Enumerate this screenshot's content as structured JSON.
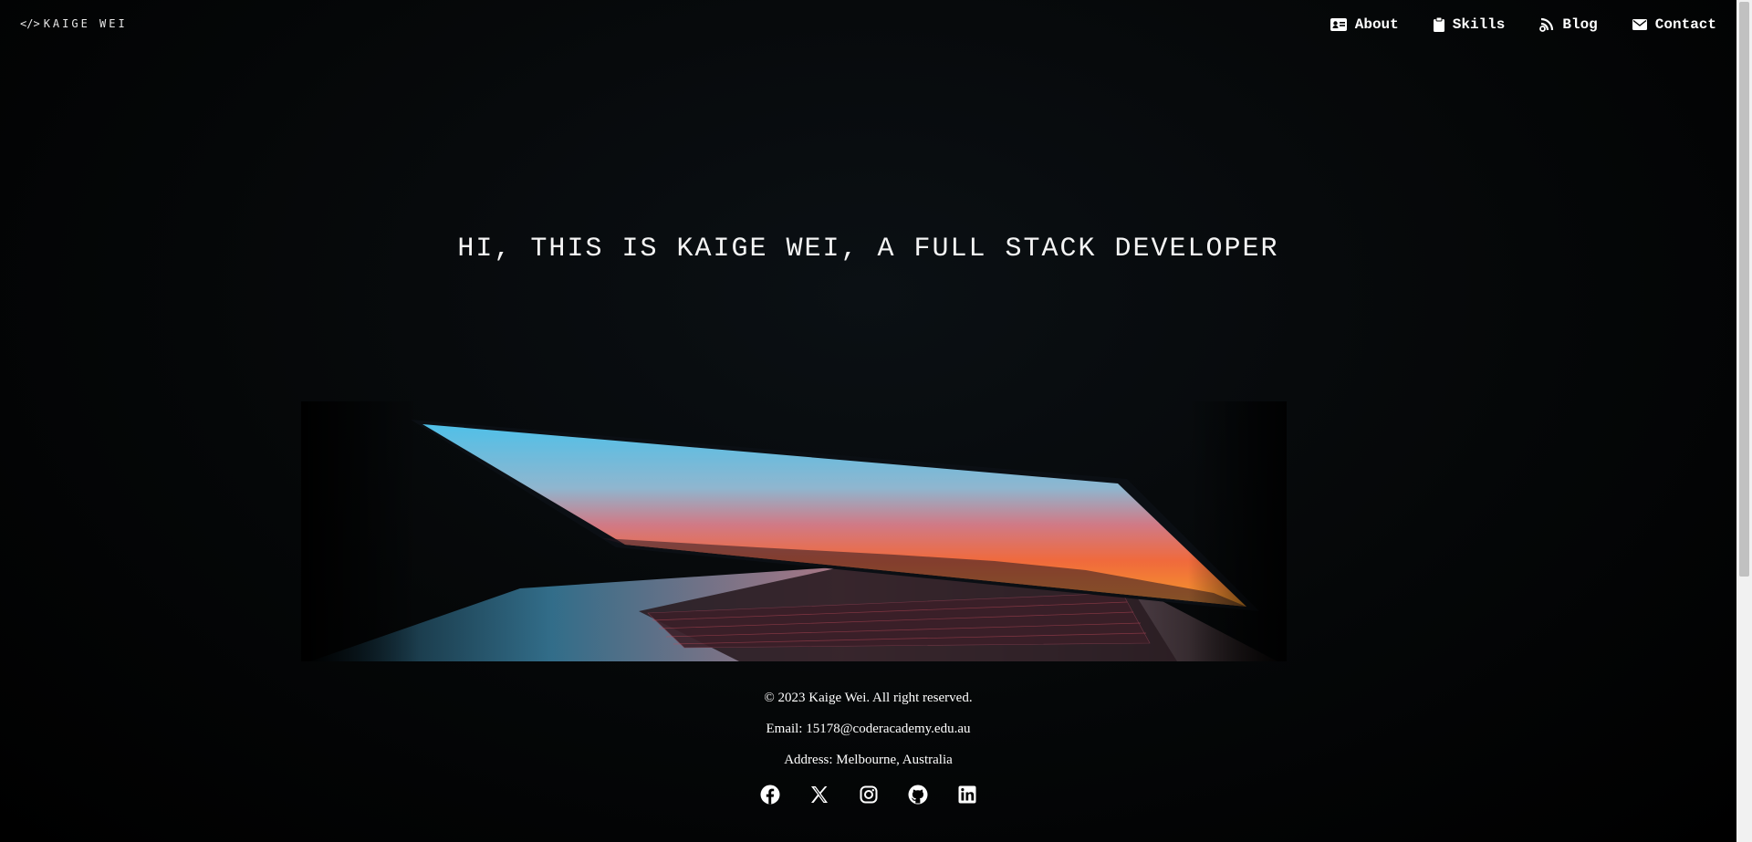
{
  "header": {
    "logo_symbol": "</>",
    "logo_text": "KAIGE WEI",
    "nav": [
      {
        "label": "About",
        "icon": "id-card-icon"
      },
      {
        "label": "Skills",
        "icon": "clipboard-icon"
      },
      {
        "label": "Blog",
        "icon": "blog-icon"
      },
      {
        "label": "Contact",
        "icon": "envelope-icon"
      }
    ]
  },
  "hero": {
    "headline": "HI, THIS IS KAIGE WEI, A FULL STACK DEVELOPER",
    "image": "laptop-at-sunset"
  },
  "footer": {
    "copyright": "© 2023 Kaige Wei. All right reserved.",
    "email": "Email: 15178@coderacademy.edu.au",
    "address": "Address: Melbourne, Australia",
    "socials": [
      "facebook-icon",
      "x-icon",
      "instagram-icon",
      "github-icon",
      "linkedin-icon"
    ]
  },
  "colors": {
    "background": "#000000",
    "text": "#ffffff",
    "scrollbar_track": "#f1f1f1",
    "scrollbar_thumb": "#c1c1c1"
  }
}
